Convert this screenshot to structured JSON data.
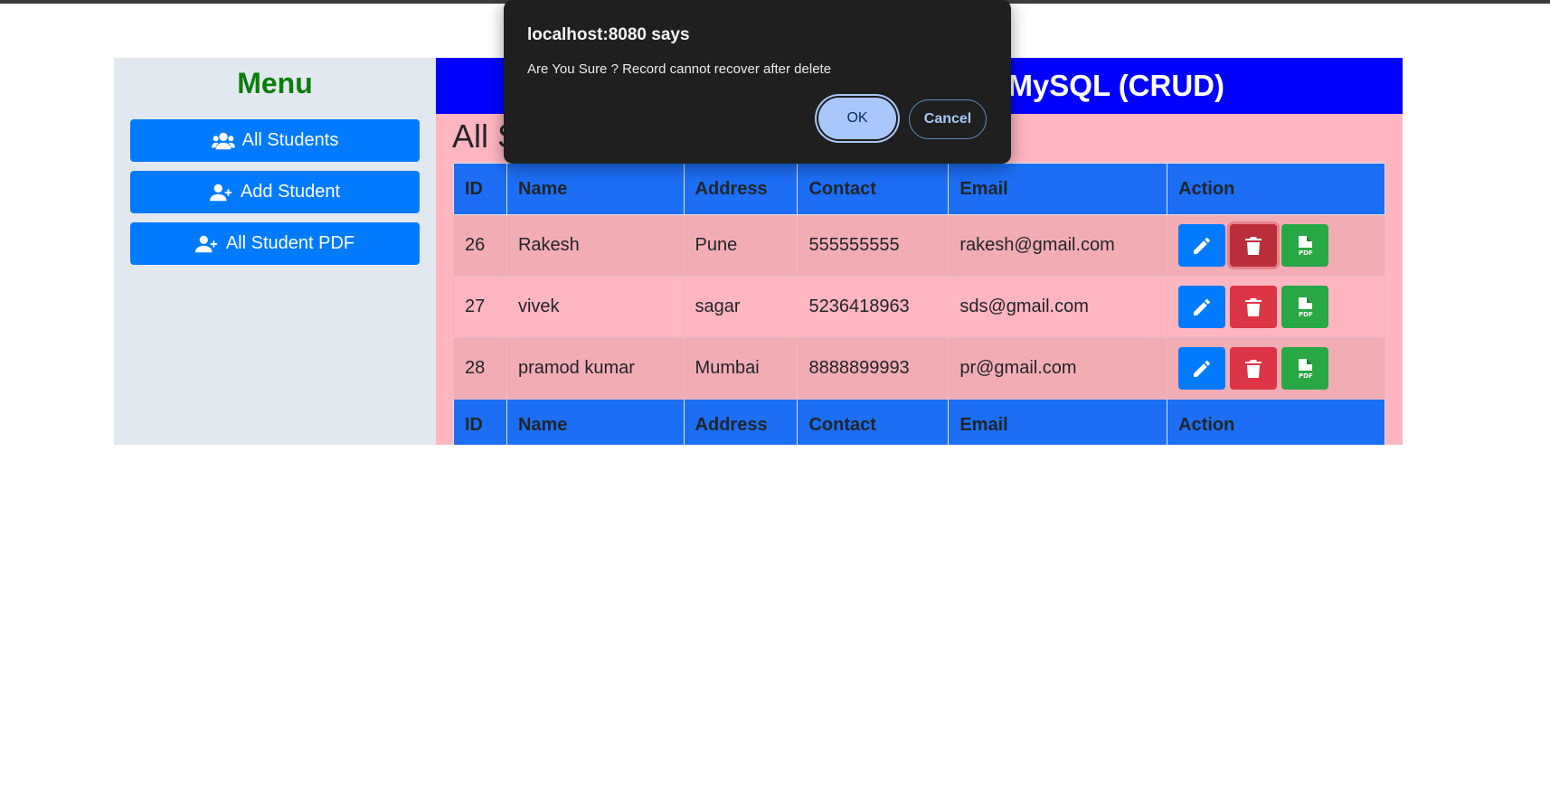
{
  "sidebar": {
    "title": "Menu",
    "buttons": [
      {
        "label": "All Students",
        "icon": "users-icon"
      },
      {
        "label": "Add Student",
        "icon": "user-plus-icon"
      },
      {
        "label": "All Student PDF",
        "icon": "user-plus-icon"
      }
    ]
  },
  "banner": {
    "title_visible": "+ MySQL (CRUD)"
  },
  "page": {
    "heading_visible": "All S"
  },
  "table": {
    "columns": [
      "ID",
      "Name",
      "Address",
      "Contact",
      "Email",
      "Action"
    ],
    "rows": [
      {
        "id": "26",
        "name": "Rakesh",
        "address": "Pune",
        "contact": "555555555",
        "email": "rakesh@gmail.com"
      },
      {
        "id": "27",
        "name": "vivek",
        "address": "sagar",
        "contact": "5236418963",
        "email": "sds@gmail.com"
      },
      {
        "id": "28",
        "name": "pramod kumar",
        "address": "Mumbai",
        "contact": "8888899993",
        "email": "pr@gmail.com"
      }
    ],
    "action_icons": [
      "pencil-icon",
      "trash-icon",
      "pdf-file-icon"
    ]
  },
  "dialog": {
    "title": "localhost:8080 says",
    "message": "Are You Sure ? Record cannot recover after delete",
    "ok_label": "OK",
    "cancel_label": "Cancel"
  },
  "colors": {
    "sidebar_bg": "#e2e8f0",
    "menu_title": "#0b7d0b",
    "primary": "#007bff",
    "banner": "#0000ff",
    "content_bg": "#ffb6c1",
    "danger": "#dc3545",
    "success": "#28a745",
    "dialog_bg": "#1f1f1f",
    "dialog_ok": "#a8c7fa"
  }
}
